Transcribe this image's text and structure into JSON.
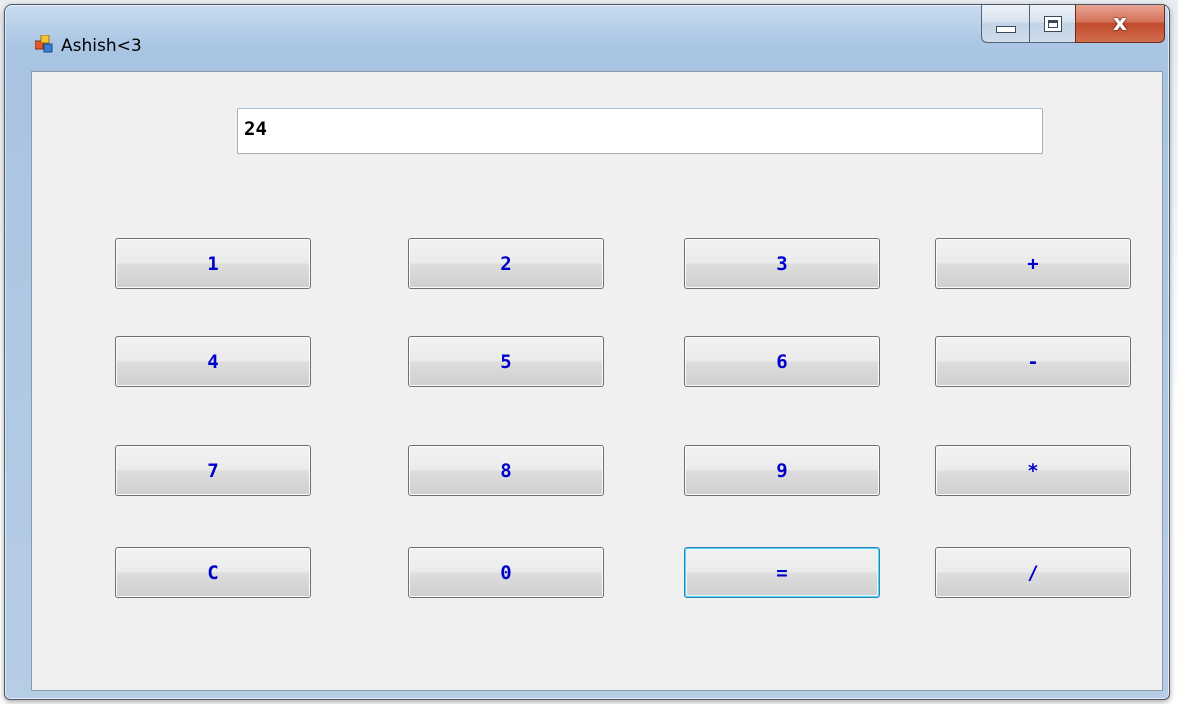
{
  "window": {
    "title": "Ashish<3",
    "close_glyph": "x"
  },
  "icons": {
    "app": "app-window-icon",
    "minimize": "minimize-icon",
    "maximize": "maximize-icon",
    "close": "close-icon"
  },
  "display": {
    "value": "24"
  },
  "keypad": {
    "rows": [
      [
        "1",
        "2",
        "3",
        "+"
      ],
      [
        "4",
        "5",
        "6",
        "-"
      ],
      [
        "7",
        "8",
        "9",
        "*"
      ],
      [
        "C",
        "0",
        "=",
        "/"
      ]
    ],
    "focused": "="
  },
  "colors": {
    "button_text": "#0000cc",
    "client_background": "#f0f0f0",
    "focus_border": "#3c7fb1"
  }
}
